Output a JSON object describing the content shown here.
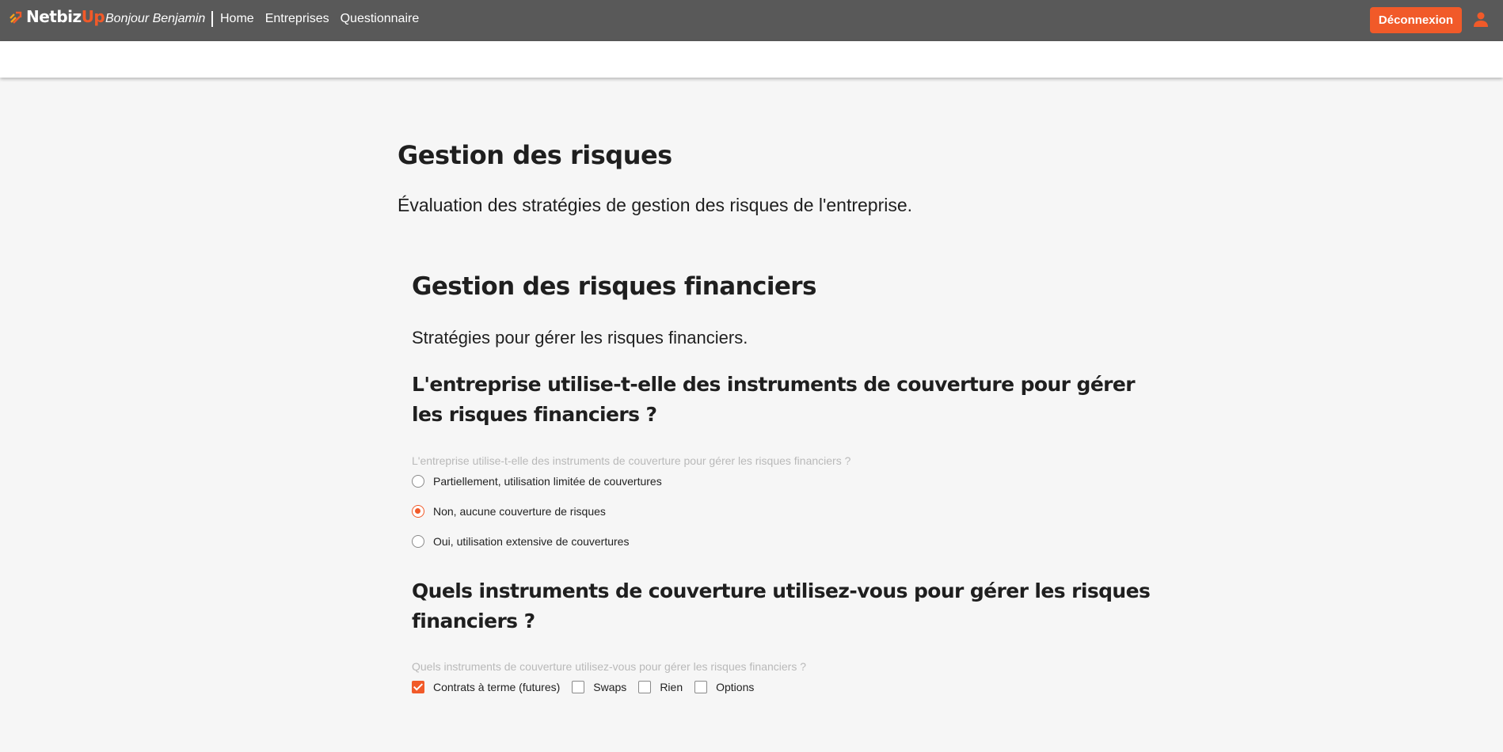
{
  "header": {
    "logo_part1": "Netbiz",
    "logo_part2": "Up",
    "greeting": "Bonjour Benjamin",
    "nav": [
      "Home",
      "Entreprises",
      "Questionnaire"
    ],
    "logout_label": "Déconnexion",
    "accent_color": "#f15a29",
    "bar_color": "#595959"
  },
  "page": {
    "title": "Gestion des risques",
    "description": "Évaluation des stratégies de gestion des risques de l'entreprise."
  },
  "section": {
    "title": "Gestion des risques financiers",
    "description": "Stratégies pour gérer les risques financiers."
  },
  "question1": {
    "title": "L'entreprise utilise-t-elle des instruments de couverture pour gérer les risques financiers ?",
    "label": "L'entreprise utilise-t-elle des instruments de couverture pour gérer les risques financiers ?",
    "options": [
      {
        "label": "Partiellement, utilisation limitée de couvertures",
        "checked": false
      },
      {
        "label": "Non, aucune couverture de risques",
        "checked": true
      },
      {
        "label": "Oui, utilisation extensive de couvertures",
        "checked": false
      }
    ]
  },
  "question2": {
    "title": "Quels instruments de couverture utilisez-vous pour gérer les risques financiers ?",
    "label": "Quels instruments de couverture utilisez-vous pour gérer les risques financiers ?",
    "options": [
      {
        "label": "Contrats à terme (futures)",
        "checked": true
      },
      {
        "label": "Swaps",
        "checked": false
      },
      {
        "label": "Rien",
        "checked": false
      },
      {
        "label": "Options",
        "checked": false
      }
    ]
  }
}
